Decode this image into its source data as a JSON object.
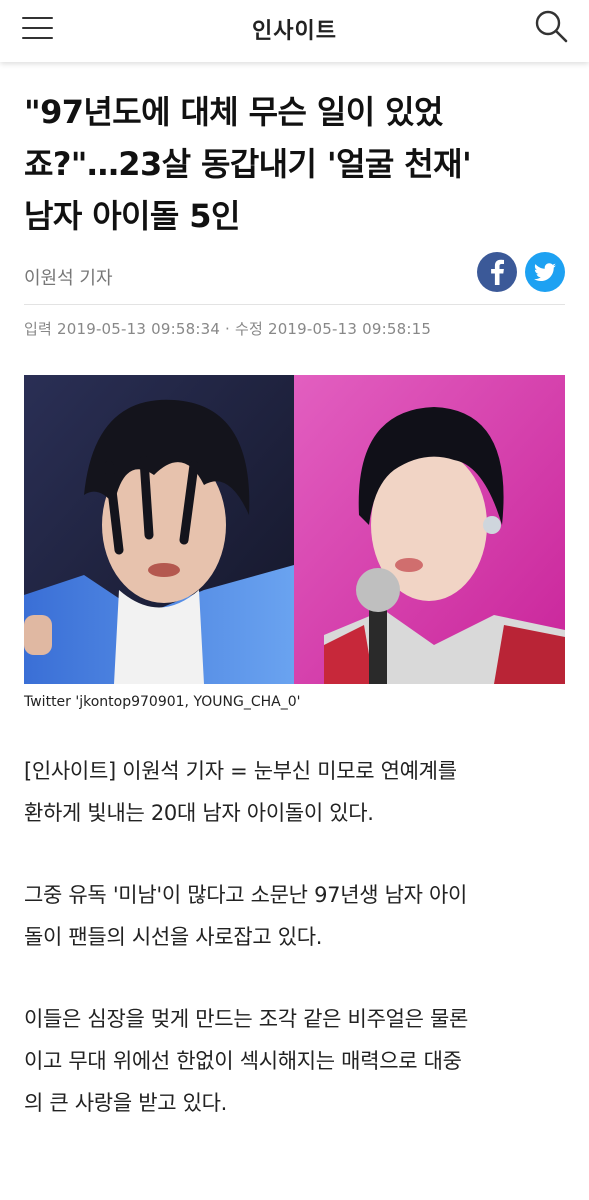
{
  "header": {
    "brand": "인사이트",
    "menu_icon": "hamburger-menu-icon",
    "search_icon": "search-icon"
  },
  "article": {
    "title_line1": "\"97년도에 대체 무슨 일이 있었",
    "title_line2": "죠?\"…23살 동갑내기 '얼굴 천재'",
    "title_line3": "남자 아이돌 5인",
    "reporter": "이원석 기자",
    "share": {
      "facebook_icon": "facebook-icon",
      "twitter_icon": "twitter-icon"
    },
    "dates": "입력 2019-05-13 09:58:34 · 수정 2019-05-13 09:58:15",
    "photo_caption": "Twitter 'jkontop970901, YOUNG_CHA_0'",
    "paragraphs": [
      {
        "line1": "[인사이트] 이원석 기자 = 눈부신 미모로 연예계를",
        "line2": "환하게 빛내는 20대 남자 아이돌이 있다."
      },
      {
        "line1": "그중 유독 '미남'이 많다고 소문난 97년생 남자 아이",
        "line2": "돌이 팬들의 시선을 사로잡고 있다."
      },
      {
        "line1": "이들은 심장을 멎게 만드는 조각 같은 비주얼은 물론",
        "line2": "이고 무대 위에선 한없이 섹시해지는 매력으로 대중",
        "line3": "의 큰 사랑을 받고 있다."
      }
    ]
  },
  "colors": {
    "facebook": "#3b5998",
    "twitter": "#1da1f2",
    "photo_left_bg": "#1c1f3a",
    "photo_right_bg": "#d43aa8"
  }
}
